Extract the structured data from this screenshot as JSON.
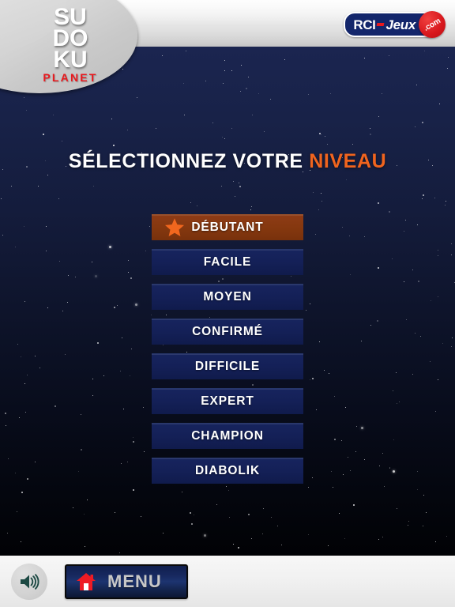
{
  "app": {
    "logo": {
      "line1": "SU",
      "line2": "DO",
      "line3": "KU",
      "subtitle": "PLANET"
    },
    "brand": {
      "prefix": "RCI",
      "name": "Jeux",
      "tld": ".com"
    }
  },
  "title": {
    "leading": "SÉLECTIONNEZ VOTRE",
    "highlight": "NIVEAU"
  },
  "levels": [
    {
      "label": "DÉBUTANT",
      "selected": true
    },
    {
      "label": "FACILE",
      "selected": false
    },
    {
      "label": "MOYEN",
      "selected": false
    },
    {
      "label": "CONFIRMÉ",
      "selected": false
    },
    {
      "label": "DIFFICILE",
      "selected": false
    },
    {
      "label": "EXPERT",
      "selected": false
    },
    {
      "label": "CHAMPION",
      "selected": false
    },
    {
      "label": "DIABOLIK",
      "selected": false
    }
  ],
  "bottom_bar": {
    "sound_icon": "speaker-on-icon",
    "menu_icon": "home-icon",
    "menu_label": "MENU"
  },
  "colors": {
    "accent_orange": "#f0641e",
    "selected_button": "#85380f",
    "button_blue": "#142057",
    "brand_red": "#e8191e",
    "brand_navy": "#13266b",
    "background_top": "#1b2550",
    "background_bottom": "#010205"
  }
}
